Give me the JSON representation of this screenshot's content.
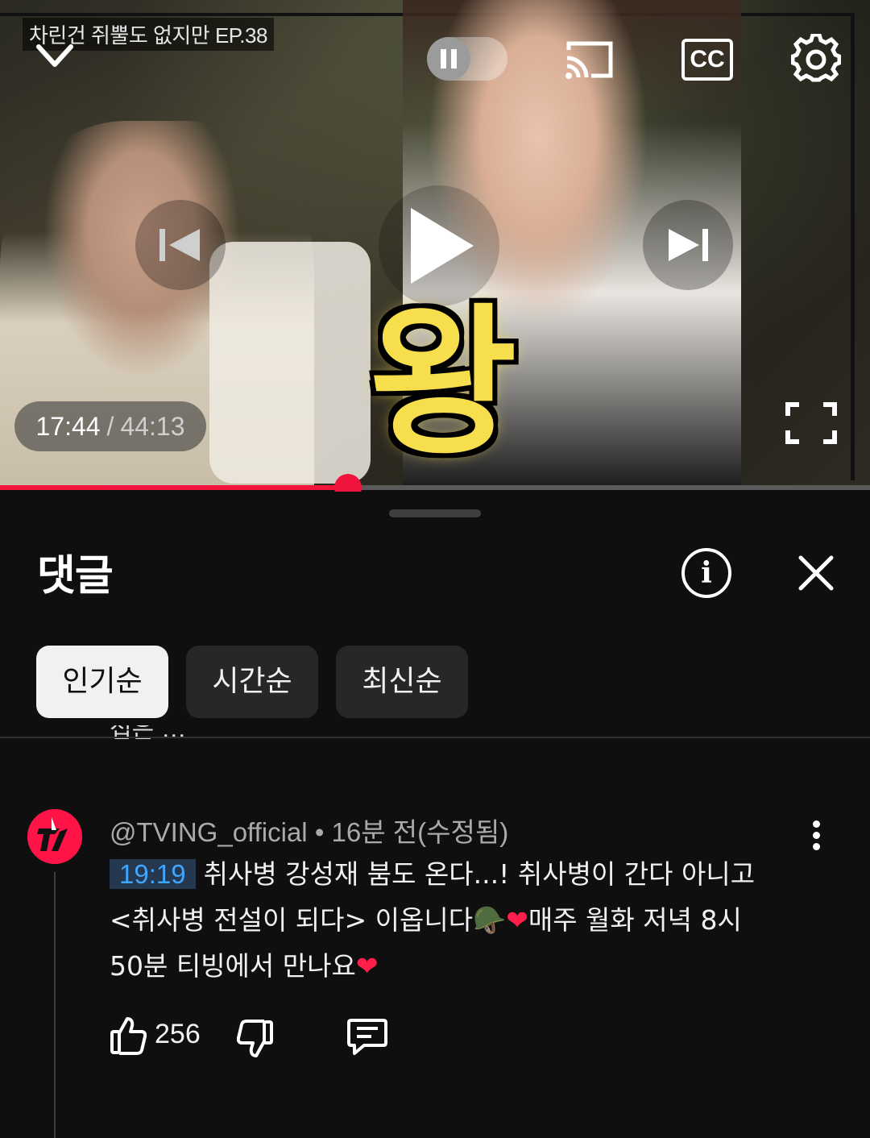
{
  "player": {
    "episode_title": "차린건 쥐뿔도 없지만 EP.38",
    "overlay_caption": "왕",
    "current_time": "17:44",
    "time_separator": "/",
    "duration": "44:13",
    "progress_fraction": 0.4,
    "paused": false,
    "cc_label": "CC",
    "icons": {
      "collapse": "chevron-down-icon",
      "pause": "pause-icon",
      "cast": "cast-icon",
      "captions": "cc-icon",
      "settings": "gear-icon",
      "previous": "skip-previous-icon",
      "play": "play-icon",
      "next": "skip-next-icon",
      "fullscreen": "fullscreen-icon"
    },
    "accent_color": "#f0143c"
  },
  "comments_panel": {
    "title": "댓글",
    "info_icon": "info-icon",
    "close_icon": "close-icon",
    "sort_chips": [
      {
        "label": "인기순",
        "active": true
      },
      {
        "label": "시간순",
        "active": false
      },
      {
        "label": "최신순",
        "active": false
      }
    ],
    "clipped_text": "접은 …",
    "comment": {
      "author": "@TVING_official",
      "dot": "•",
      "time": "16분 전(수정됨)",
      "timestamp_link": "19:19",
      "text_line1": "취사병 강성재 붐도 온다...! 취사병이 간다 아니고",
      "text_line2a": "<취사병 전설이 되다> 이옵니다",
      "emoji_helmet": "🪖",
      "emoji_heart1": "❤",
      "text_line2b": "매주 월화 저녁 8시",
      "text_line3": "50분 티빙에서 만나요",
      "emoji_heart2": "❤",
      "likes": "256",
      "link_color": "#3ea6ff",
      "avatar_color": "#ff1447"
    }
  }
}
